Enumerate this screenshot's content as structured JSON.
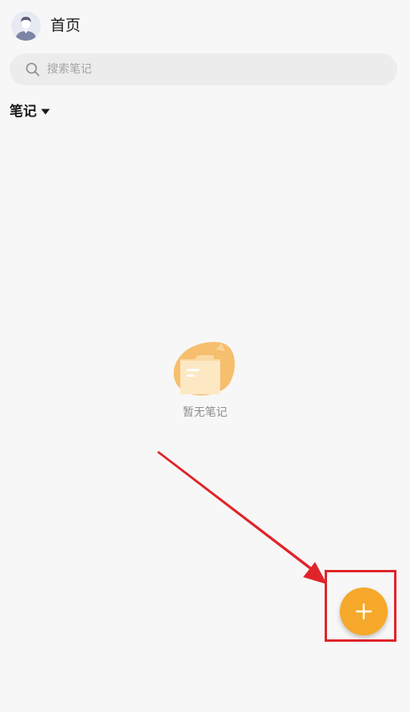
{
  "header": {
    "title": "首页",
    "avatar_icon": "user-avatar-icon"
  },
  "search": {
    "placeholder": "搜索笔记",
    "value": "",
    "icon": "search-icon"
  },
  "section": {
    "label": "笔记",
    "icon": "caret-down-icon"
  },
  "empty_state": {
    "icon": "empty-folder-icon",
    "text": "暂无笔记"
  },
  "fab": {
    "icon": "plus-icon"
  },
  "colors": {
    "background": "#f7f7f7",
    "accent": "#f6a82a",
    "annotation": "#e0242a"
  }
}
